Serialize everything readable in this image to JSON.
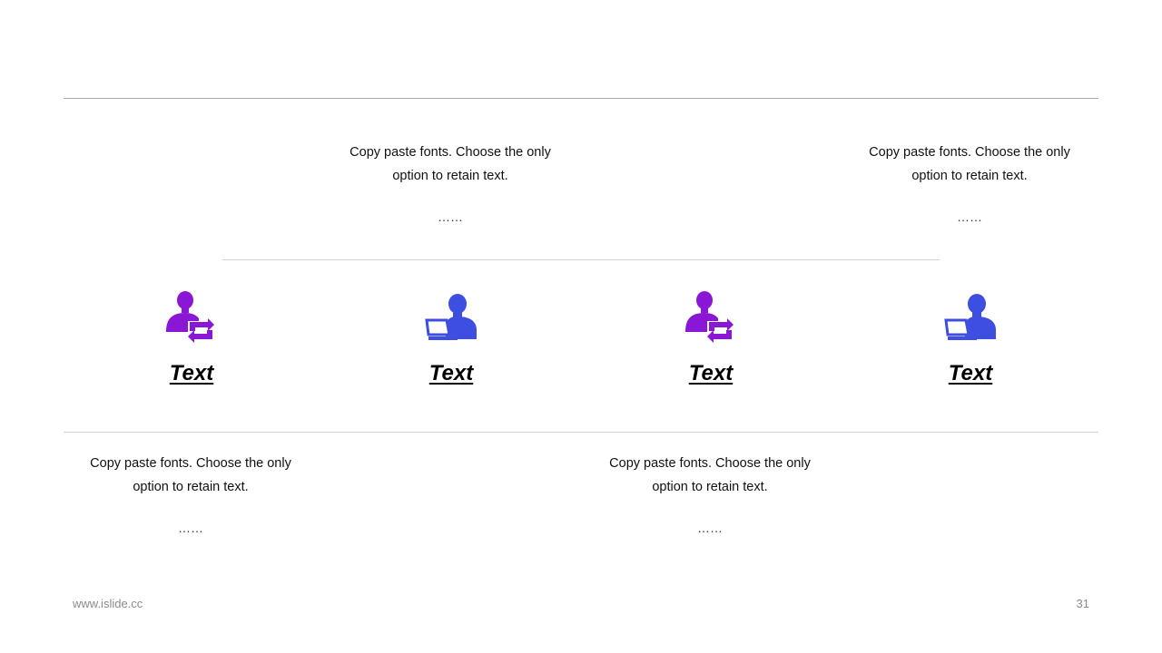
{
  "colors": {
    "purple": "#8a16d6",
    "blue": "#3d4ee0",
    "rule": "#a9a9a9"
  },
  "top_blocks": [
    {
      "text": "Copy paste fonts. Choose the only option to retain text.",
      "dots": "……"
    },
    {
      "text": "Copy paste fonts. Choose the only option to retain text.",
      "dots": "……"
    }
  ],
  "bottom_blocks": [
    {
      "text": "Copy paste fonts. Choose the only option to retain text.",
      "dots": "……"
    },
    {
      "text": "Copy paste fonts. Choose the only option to retain text.",
      "dots": "……"
    }
  ],
  "items": [
    {
      "label": "Text",
      "icon": "user-exchange-icon",
      "color": "purple"
    },
    {
      "label": "Text",
      "icon": "user-laptop-icon",
      "color": "blue"
    },
    {
      "label": "Text",
      "icon": "user-exchange-icon",
      "color": "purple"
    },
    {
      "label": "Text",
      "icon": "user-laptop-icon",
      "color": "blue"
    }
  ],
  "footer": {
    "url": "www.islide.cc",
    "page": "31"
  }
}
